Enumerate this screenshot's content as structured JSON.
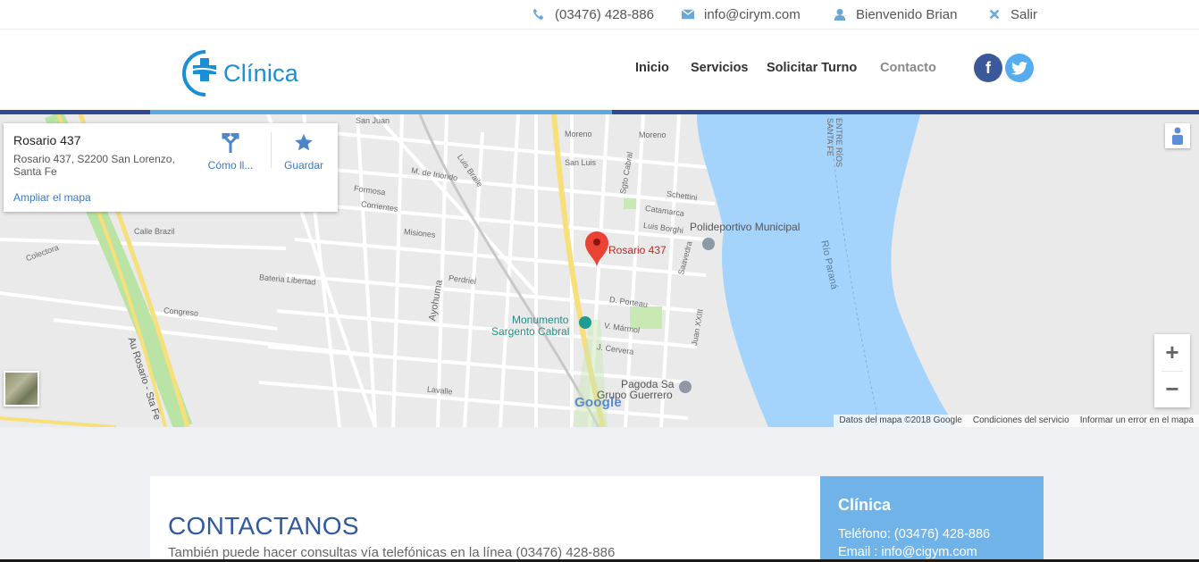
{
  "topbar": {
    "phone": "(03476) 428-886",
    "email": "info@cirym.com",
    "welcome": "Bienvenido Brian",
    "logout": "Salir"
  },
  "header": {
    "brand": "Clínica",
    "nav": [
      "Inicio",
      "Servicios",
      "Solicitar Turno",
      "Contacto"
    ],
    "active_nav": "Contacto",
    "social": {
      "facebook": "f",
      "twitter": "twitter-icon"
    }
  },
  "map": {
    "place_title": "Rosario 437",
    "place_address": "Rosario 437, S2200 San Lorenzo, Santa Fe",
    "directions_label": "Cómo ll...",
    "save_label": "Guardar",
    "expand_link": "Ampliar el mapa",
    "pin_label": "Rosario 437",
    "pois": {
      "polideportivo": "Polideportivo Municipal",
      "monumento_line1": "Monumento",
      "monumento_line2": "Sargento Cabral",
      "pagoda_line1": "Pagoda Sa",
      "pagoda_line2": "Grupo Guerrero"
    },
    "river_label": "Río Paraná",
    "brand_mark": "Google",
    "attribution": {
      "data": "Datos del mapa ©2018 Google",
      "terms": "Condiciones del servicio",
      "report": "Informar un error en el mapa"
    },
    "zoom_in": "+",
    "zoom_out": "−",
    "street_labels": {
      "san_juan": "San Juan",
      "moreno_1": "Moreno",
      "moreno_2": "Moreno",
      "san_luis": "San Luis",
      "sgto_cabral": "Sgto Cabral",
      "m_iriondo": "M. de Iriondo",
      "luis_braile": "Luis Braile",
      "formosa": "Formosa",
      "corrientes": "Corrientes",
      "misiones": "Misiones",
      "calle_brazil": "Calle Brazil",
      "colectora": "Colectora",
      "bateria": "Bateria Libertad",
      "congreso": "Congreso",
      "ayohuma": "Ayohuma",
      "perdriel": "Perdriel",
      "d_porteau": "D. Porteau",
      "v_marmol": "V. Mármol",
      "j_cervera": "J. Cervera",
      "lavalle": "Lavalle",
      "au_rosario": "Au Rosario - Sta Fe",
      "catamarca": "Catamarca",
      "schettini": "Schettini",
      "luis_borghi": "Luis Borghi",
      "saavedra": "Saavedra",
      "juan_xxiii": "Juan XXIII",
      "entre_rios": "ENTRE RÍOS",
      "santa_fe": "SANTA FE"
    }
  },
  "contact": {
    "heading": "CONTACTANOS",
    "text": "También puede hacer consultas vía telefónicas en la línea (03476) 428-886"
  },
  "sidebar": {
    "title": "Clínica",
    "phone_line": "Teléfono: (03476) 428-886",
    "email_line": "Email : info@cigym.com"
  },
  "colors": {
    "brand_blue": "#1a8fd5",
    "accent_dark": "#2d4a8f",
    "accent_light": "#5aa8e0",
    "sidebar_bg": "#6fb3e9",
    "heading_blue": "#2f5a9e",
    "river": "#a4d4fb"
  }
}
